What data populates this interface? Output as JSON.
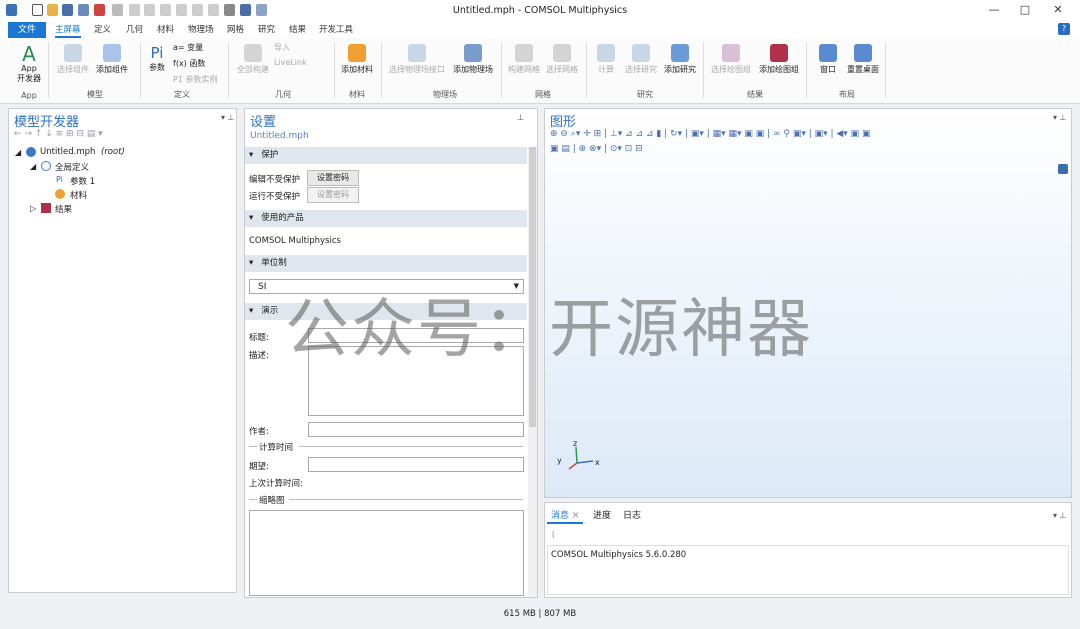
{
  "window": {
    "title": "Untitled.mph - COMSOL Multiphysics"
  },
  "menu": {
    "file": "文件",
    "tabs": [
      "主屏幕",
      "定义",
      "几何",
      "材料",
      "物理场",
      "网格",
      "研究",
      "结果",
      "开发工具"
    ]
  },
  "ribbon": {
    "app_label1": "App",
    "app_label2": "开发器",
    "model": [
      "选择组件",
      "添加组件"
    ],
    "param": "参数",
    "var": "a= 变量",
    "func": "f(x) 函数",
    "param_case": "P1 参数实例",
    "geom": [
      "全部构建",
      "导入",
      "LiveLink"
    ],
    "add_material": "添加材料",
    "physics": [
      "选择物理场接口",
      "添加物理场"
    ],
    "mesh": [
      "构建网格",
      "选择网格"
    ],
    "study": [
      "计算",
      "选择研究",
      "添加研究"
    ],
    "results": [
      "选择绘图组",
      "添加绘图组"
    ],
    "layout": [
      "窗口",
      "重置桌面"
    ],
    "groups": [
      "App",
      "模型",
      "定义",
      "几何",
      "材料",
      "物理场",
      "网格",
      "研究",
      "结果",
      "布局"
    ]
  },
  "builder": {
    "title": "模型开发器",
    "tree": {
      "root": "Untitled.mph",
      "root_tag": "(root)",
      "global": "全局定义",
      "param": "参数 1",
      "material": "材料",
      "results": "结果"
    }
  },
  "settings": {
    "title": "设置",
    "file": "Untitled.mph",
    "protection": "保护",
    "edit_protect": "编辑不受保护",
    "run_protect": "运行不受保护",
    "set_password": "设置密码",
    "products": "使用的产品",
    "product_name": "COMSOL Multiphysics",
    "units": "单位制",
    "unit_value": "SI",
    "presentation": "演示",
    "title_label": "标题:",
    "desc_label": "描述:",
    "author_label": "作者:",
    "calc_time": "计算时间",
    "expected": "期望:",
    "last_calc": "上次计算时间:",
    "thumbnail": "缩略图"
  },
  "graphics": {
    "title": "图形",
    "axes": {
      "x": "x",
      "y": "y",
      "z": "z"
    }
  },
  "messages": {
    "tabs": [
      "消息",
      "进度",
      "日志"
    ],
    "text": "COMSOL Multiphysics 5.6.0.280"
  },
  "status": {
    "memory": "615 MB | 807 MB"
  },
  "watermark": "公众号：开源神器",
  "colors": {
    "accent": "#1a78d4",
    "title_blue": "#2a72c4"
  }
}
